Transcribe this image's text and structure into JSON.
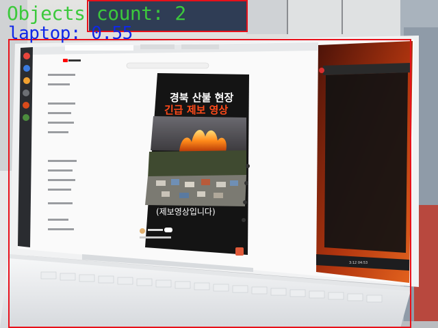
{
  "overlay": {
    "count_text": "Objects count: 2",
    "detection_label": "laptop: 0.55",
    "colors": {
      "count_text": "#3cc93c",
      "label_text": "#1028e8",
      "box": "#e8101a"
    }
  },
  "screen": {
    "video_title_line1": "경북 산불 현장",
    "video_title_line2": "긴급 제보 영상",
    "video_caption": "(제보영상입니다)"
  },
  "taskbar": {
    "clock": "3:12 04:53"
  }
}
